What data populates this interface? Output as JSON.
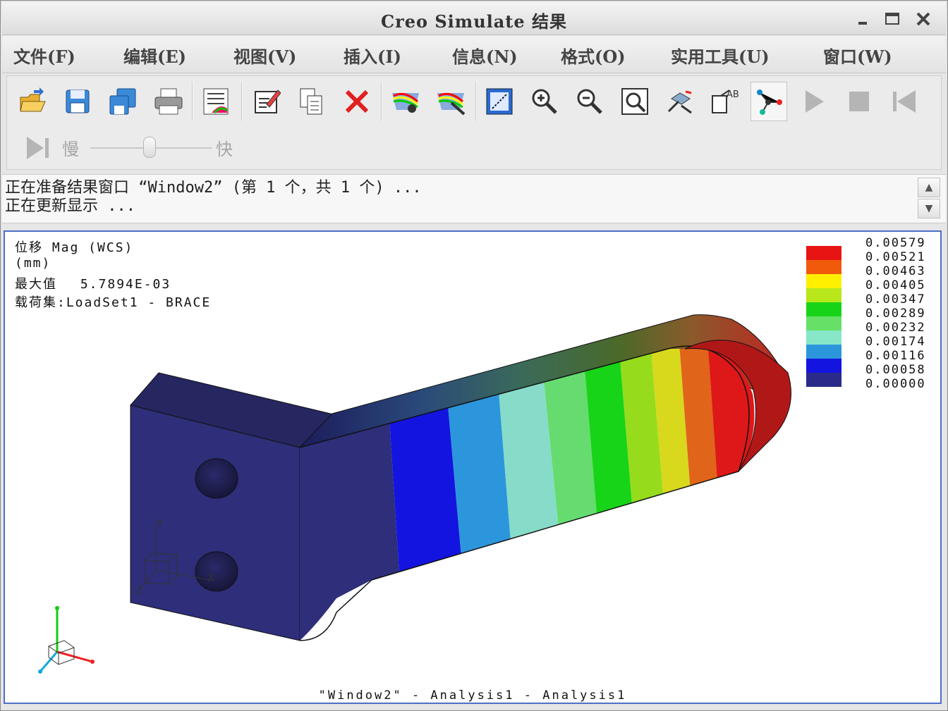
{
  "window": {
    "title": "Creo Simulate 结果"
  },
  "menu": {
    "items": [
      "文件(F)",
      "编辑(E)",
      "视图(V)",
      "插入(I)",
      "信息(N)",
      "格式(O)",
      "实用工具(U)",
      "窗口(W)"
    ]
  },
  "toolbar": {
    "buttons": [
      "open-icon",
      "save-icon",
      "save-copy-icon",
      "print-icon",
      "result-list-icon",
      "edit-definition-icon",
      "copy-icon",
      "delete-icon",
      "show-icon",
      "hide-icon",
      "view-fit-icon",
      "zoom-in-icon",
      "zoom-out-icon",
      "zoom-window-icon",
      "spin-icon",
      "annotation-icon",
      "query-node-icon",
      "play-icon",
      "stop-icon",
      "first-frame-icon",
      "last-frame-icon"
    ],
    "speed_slow": "慢",
    "speed_fast": "快",
    "speed_value": 0.5
  },
  "messages": {
    "line1": "正在准备结果窗口 “Window2” (第 1 个，共 1 个) ...",
    "line2": "正在更新显示 ..."
  },
  "viewport": {
    "info_line1": "位移 Mag (WCS)",
    "info_line2": "(mm)",
    "info_line3_label": "最大值",
    "info_line3_value": "5.7894E-03",
    "info_line4_label": "载荷集",
    "info_line4_value": ":LoadSet1 -  BRACE",
    "footer": "\"Window2\" - Analysis1 - Analysis1",
    "axis_x": "X",
    "axis_y": "Y",
    "axis_z": "Z"
  },
  "legend": {
    "values": [
      "0.00579",
      "0.00521",
      "0.00463",
      "0.00405",
      "0.00347",
      "0.00289",
      "0.00232",
      "0.00174",
      "0.00116",
      "0.00058",
      "0.00000"
    ],
    "colors": [
      "#e81414",
      "#f05a0a",
      "#fff000",
      "#b8e81c",
      "#18d418",
      "#66e066",
      "#86e8c8",
      "#2c96dc",
      "#1414e0",
      "#2a2a8a"
    ]
  },
  "colors": {
    "accent_border": "#4d6fc6",
    "part_base": "#2e2e7a"
  }
}
